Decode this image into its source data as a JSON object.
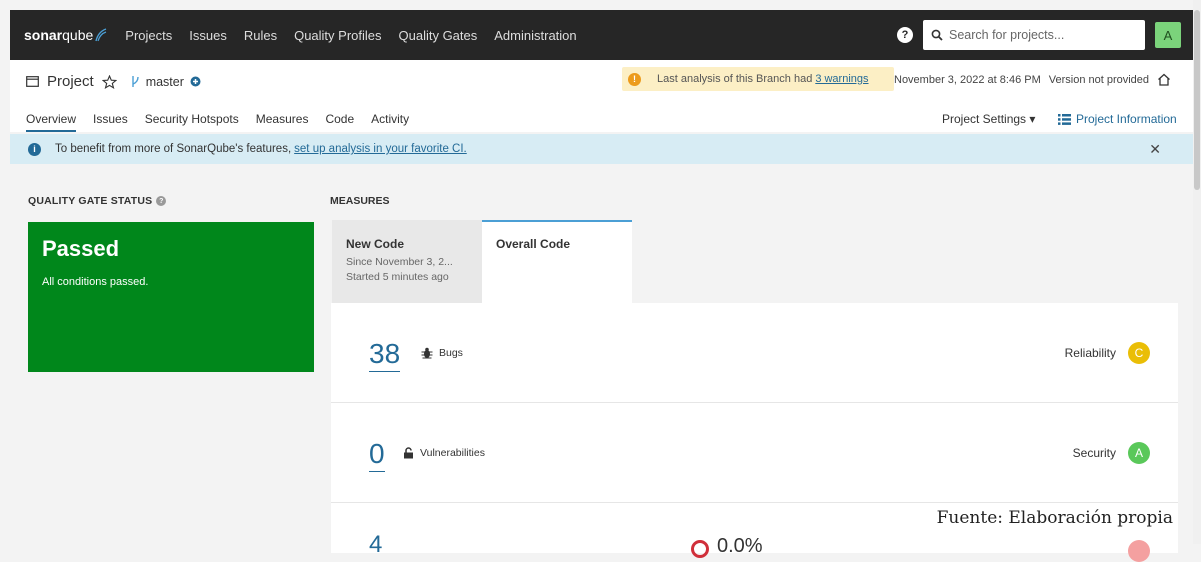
{
  "navbar": {
    "brand_bold": "sonar",
    "brand_light": "qube",
    "items": [
      "Projects",
      "Issues",
      "Rules",
      "Quality Profiles",
      "Quality Gates",
      "Administration"
    ],
    "help_icon": "help-icon",
    "search_placeholder": "Search for projects...",
    "avatar": "A"
  },
  "project": {
    "name": "Project",
    "branch": "master",
    "warning_text": "Last analysis of this Branch had",
    "warning_link": "3 warnings",
    "date": "November 3, 2022 at 8:46 PM",
    "version": "Version not provided",
    "tabs": [
      "Overview",
      "Issues",
      "Security Hotspots",
      "Measures",
      "Code",
      "Activity"
    ],
    "settings": "Project Settings ▾",
    "info": "Project Information"
  },
  "banner": {
    "text": "To benefit from more of SonarQube's features,",
    "link": "set up analysis in your favorite CI.",
    "close": "✕"
  },
  "quality_gate": {
    "title": "QUALITY GATE STATUS",
    "status": "Passed",
    "detail": "All conditions passed."
  },
  "measures": {
    "title": "MEASURES",
    "tab_new": {
      "title": "New Code",
      "line1": "Since November 3, 2...",
      "line2": "Started 5 minutes ago"
    },
    "tab_overall": {
      "title": "Overall Code"
    },
    "rows": [
      {
        "value": "38",
        "label": "Bugs",
        "rating_label": "Reliability",
        "rating": "C",
        "rating_color": "#eabe06"
      },
      {
        "value": "0",
        "label": "Vulnerabilities",
        "rating_label": "Security",
        "rating": "A",
        "rating_color": "#00aa00"
      }
    ],
    "partial_value": "4",
    "partial_pct": "0.0%"
  },
  "caption": "Fuente: Elaboración propia",
  "colors": {
    "accent": "#236a97",
    "passed": "#00871b",
    "navbar": "#262626"
  }
}
